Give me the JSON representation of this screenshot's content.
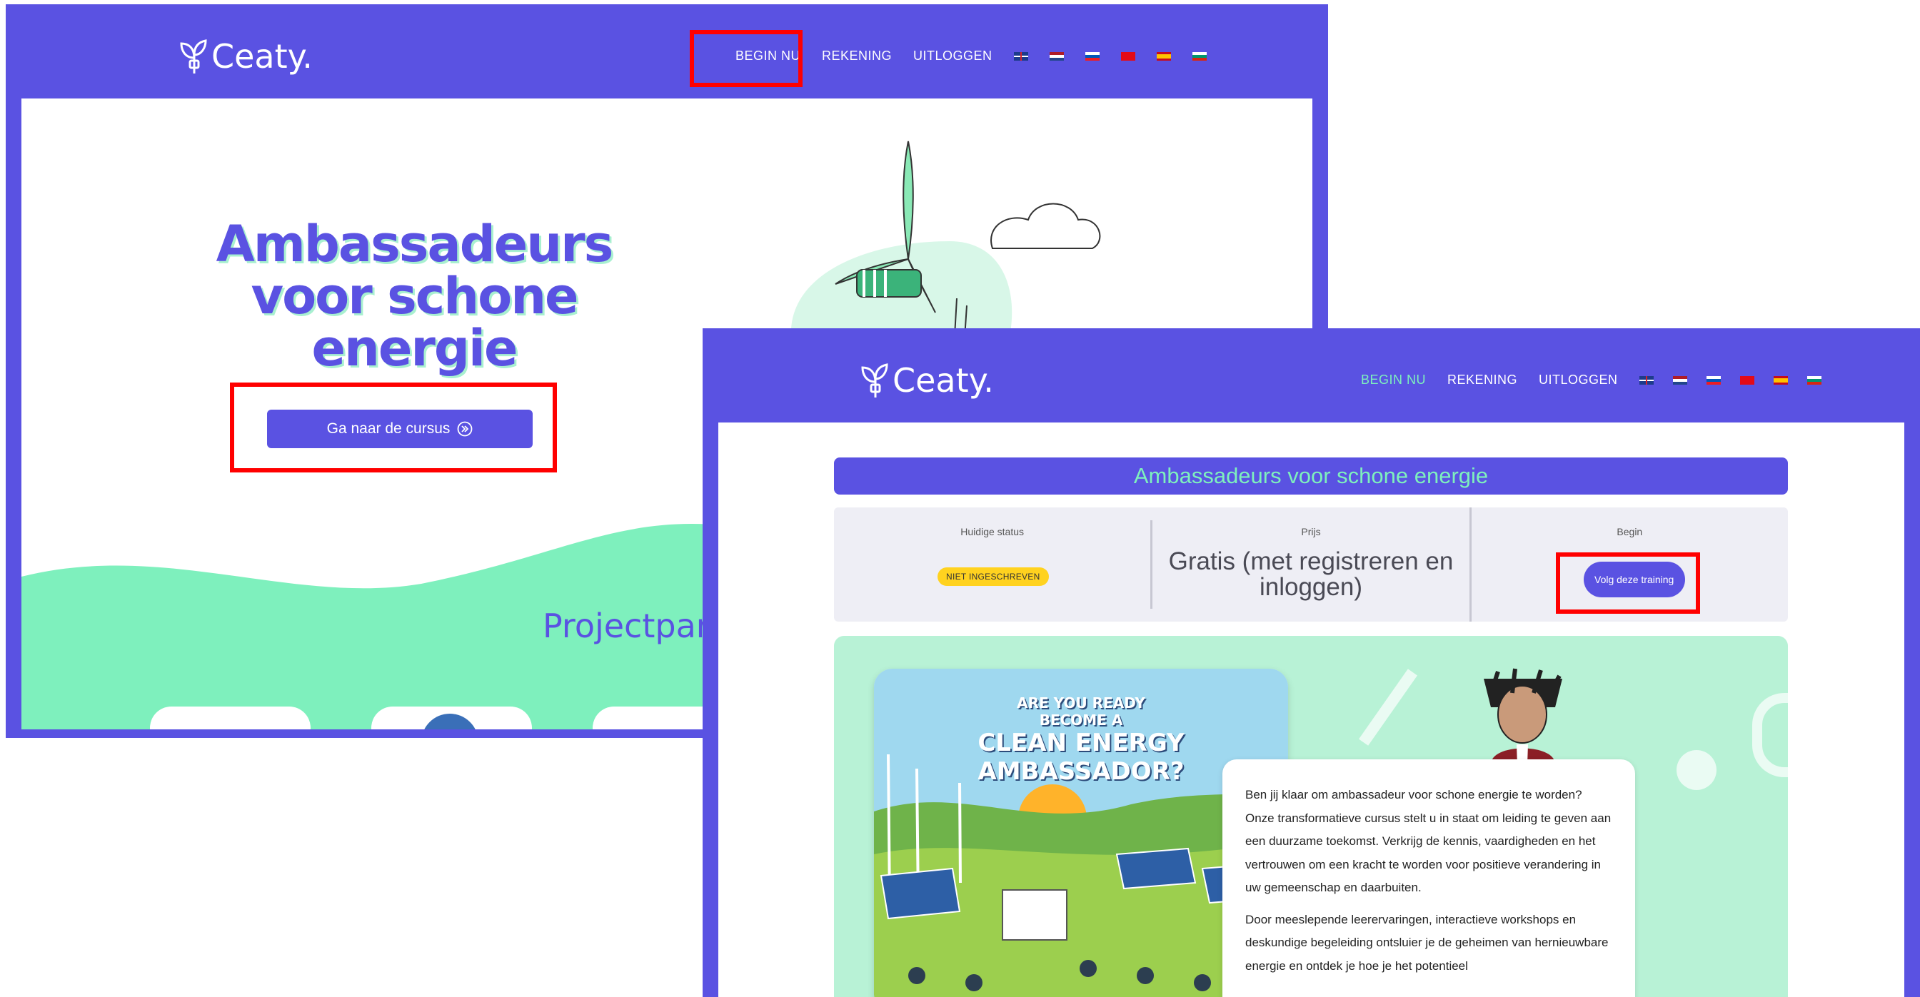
{
  "window1": {
    "logo": "Ceaty.",
    "nav": {
      "items": [
        "BEGIN NU",
        "REKENING",
        "UITLOGGEN"
      ],
      "flags": [
        "uk-flag",
        "netherlands-flag",
        "slovenia-flag",
        "turkey-flag",
        "spain-flag",
        "bulgaria-flag"
      ]
    },
    "hero_title": "Ambassadeurs voor schone energie",
    "hero_title_lines": [
      "Ambassadeurs",
      "voor schone",
      "energie"
    ],
    "cta": "Ga naar de cursus",
    "section_heading": "Projectpar"
  },
  "window2": {
    "logo": "Ceaty.",
    "nav": {
      "items": [
        "BEGIN NU",
        "REKENING",
        "UITLOGGEN"
      ],
      "active_index": 0
    },
    "course_title": "Ambassadeurs voor schone energie",
    "status": {
      "current_label": "Huidige status",
      "current_value": "NIET INGESCHREVEN",
      "price_label": "Prijs",
      "price_value": "Gratis (met registreren en inloggen)",
      "start_label": "Begin",
      "start_button": "Volg deze training"
    },
    "poster_lines": [
      "ARE YOU READY",
      "BECOME A",
      "CLEAN ENERGY",
      "AMBASSADOR?"
    ],
    "description": {
      "p1": "Ben jij klaar om ambassadeur voor schone energie te worden? Onze transformatieve cursus stelt u in staat om leiding te geven aan een duurzame toekomst. Verkrijg de kennis, vaardigheden en het vertrouwen om een kracht te worden voor positieve verandering in uw gemeenschap en daarbuiten.",
      "p2": "Door meeslepende leerervaringen, interactieve workshops en deskundige begeleiding ontsluier je de geheimen van hernieuwbare energie en ontdek je hoe je het potentieel"
    }
  },
  "colors": {
    "brand": "#5a52e2",
    "mint": "#7ef0bd",
    "highlight": "#ff0000",
    "badge": "#ffd21f"
  }
}
